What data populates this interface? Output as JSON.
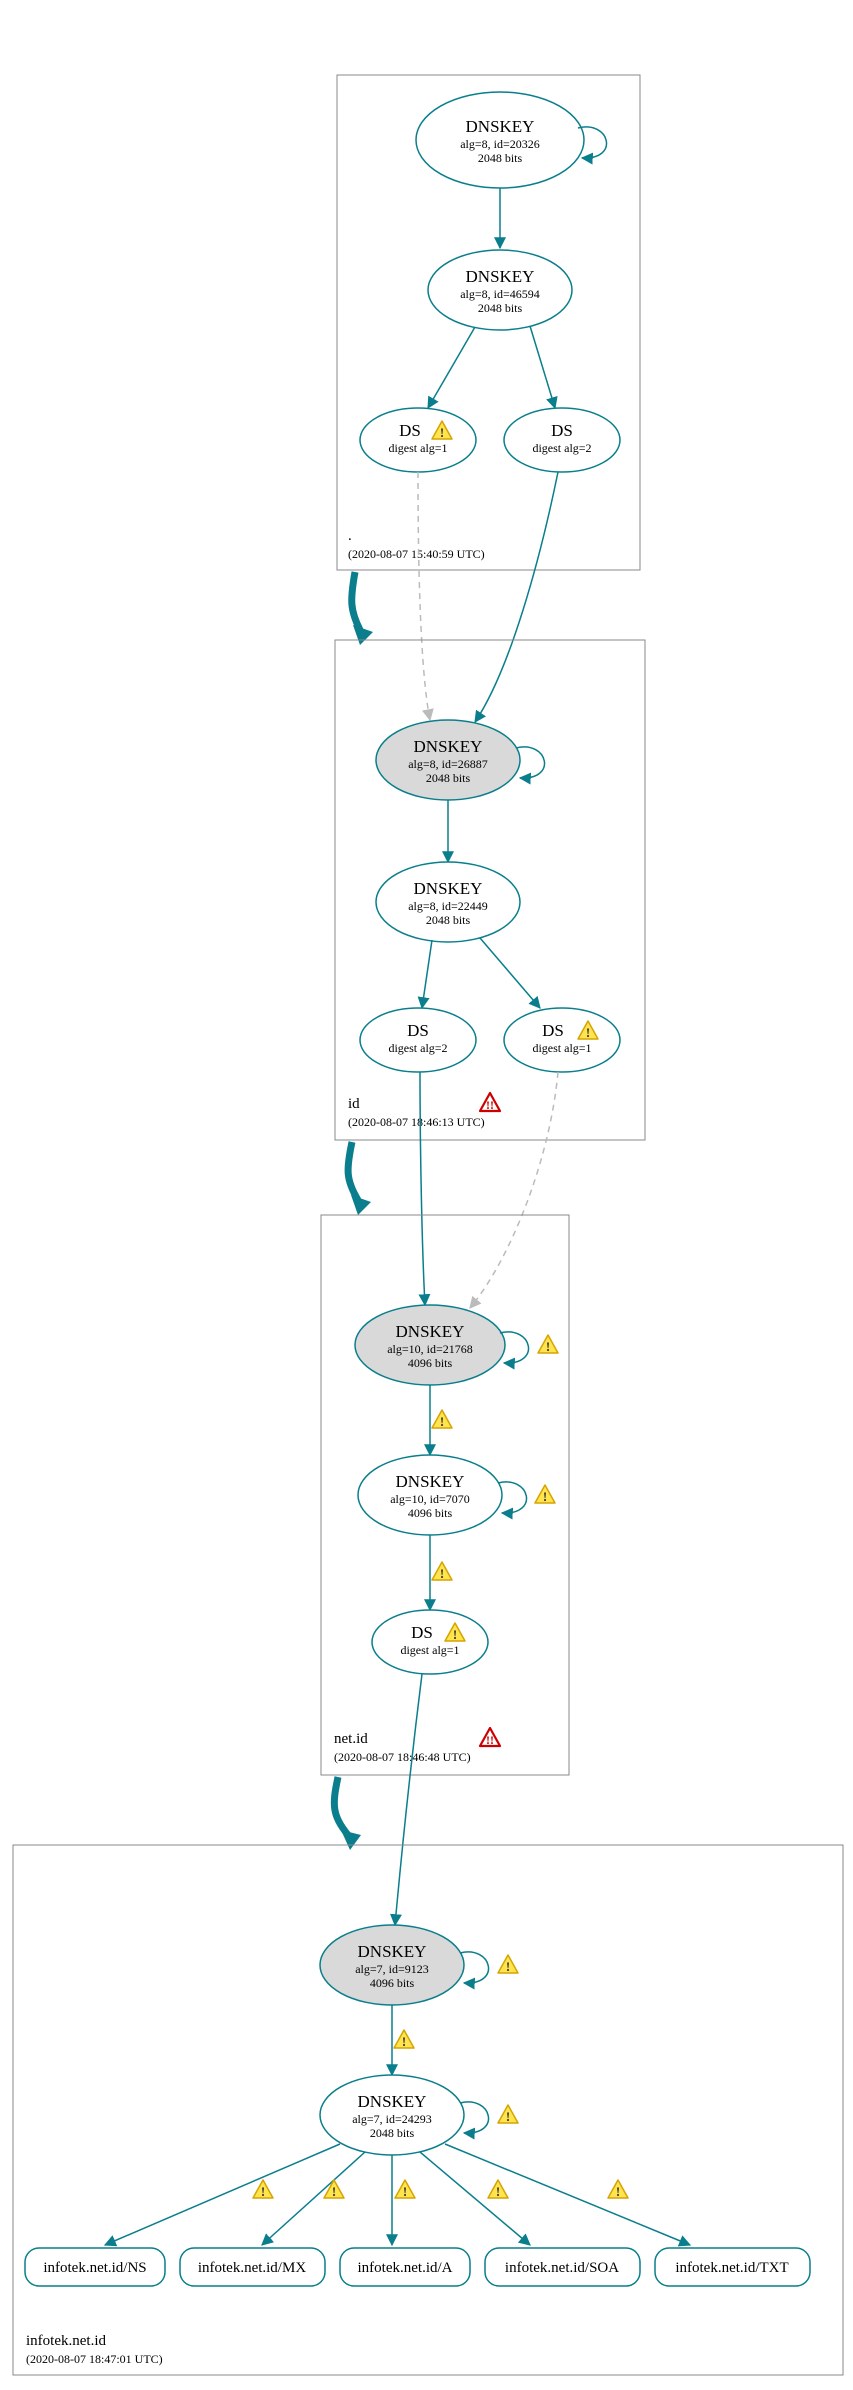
{
  "zones": {
    "root": {
      "label": ".",
      "time": "(2020-08-07 15:40:59 UTC)"
    },
    "id": {
      "label": "id",
      "time": "(2020-08-07 18:46:13 UTC)"
    },
    "netid": {
      "label": "net.id",
      "time": "(2020-08-07 18:46:48 UTC)"
    },
    "inf": {
      "label": "infotek.net.id",
      "time": "(2020-08-07 18:47:01 UTC)"
    }
  },
  "nodes": {
    "root_ksk": {
      "title": "DNSKEY",
      "l1": "alg=8, id=20326",
      "l2": "2048 bits"
    },
    "root_zsk": {
      "title": "DNSKEY",
      "l1": "alg=8, id=46594",
      "l2": "2048 bits"
    },
    "root_ds1": {
      "title": "DS",
      "l1": "digest alg=1"
    },
    "root_ds2": {
      "title": "DS",
      "l1": "digest alg=2"
    },
    "id_ksk": {
      "title": "DNSKEY",
      "l1": "alg=8, id=26887",
      "l2": "2048 bits"
    },
    "id_zsk": {
      "title": "DNSKEY",
      "l1": "alg=8, id=22449",
      "l2": "2048 bits"
    },
    "id_ds2": {
      "title": "DS",
      "l1": "digest alg=2"
    },
    "id_ds1": {
      "title": "DS",
      "l1": "digest alg=1"
    },
    "netid_ksk": {
      "title": "DNSKEY",
      "l1": "alg=10, id=21768",
      "l2": "4096 bits"
    },
    "netid_zsk": {
      "title": "DNSKEY",
      "l1": "alg=10, id=7070",
      "l2": "4096 bits"
    },
    "netid_ds1": {
      "title": "DS",
      "l1": "digest alg=1"
    },
    "inf_ksk": {
      "title": "DNSKEY",
      "l1": "alg=7, id=9123",
      "l2": "4096 bits"
    },
    "inf_zsk": {
      "title": "DNSKEY",
      "l1": "alg=7, id=24293",
      "l2": "2048 bits"
    }
  },
  "records": {
    "ns": "infotek.net.id/NS",
    "mx": "infotek.net.id/MX",
    "a": "infotek.net.id/A",
    "soa": "infotek.net.id/SOA",
    "txt": "infotek.net.id/TXT"
  }
}
